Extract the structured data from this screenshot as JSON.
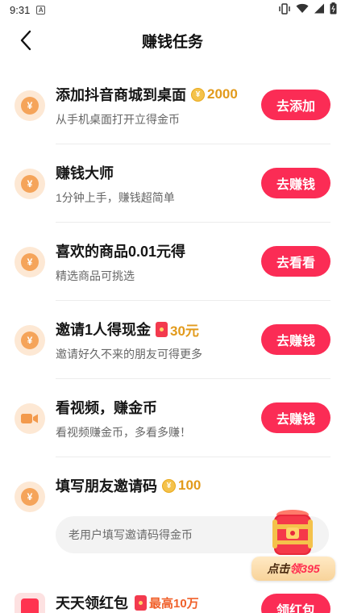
{
  "status_bar": {
    "time": "9:31"
  },
  "header": {
    "title": "赚钱任务"
  },
  "tasks": [
    {
      "title": "添加抖音商城到桌面",
      "reward": "2000",
      "subtitle": "从手机桌面打开立得金币",
      "button": "去添加",
      "icon": "coin-icon"
    },
    {
      "title": "赚钱大师",
      "reward": "",
      "subtitle": "1分钟上手，赚钱超简单",
      "button": "去赚钱",
      "icon": "coin-icon"
    },
    {
      "title": "喜欢的商品0.01元得",
      "reward": "",
      "subtitle": "精选商品可挑选",
      "button": "去看看",
      "icon": "coin-icon"
    },
    {
      "title": "邀请1人得现金",
      "reward": "30元",
      "subtitle": "邀请好久不来的朋友可得更多",
      "button": "去赚钱",
      "icon": "coin-icon"
    },
    {
      "title": "看视频，赚金币",
      "reward": "",
      "subtitle": "看视频赚金币，多看多赚！",
      "button": "去赚钱",
      "icon": "video-camera-icon"
    }
  ],
  "invite_code": {
    "title": "填写朋友邀请码",
    "reward": "100",
    "placeholder": "老用户填写邀请码得金币",
    "value": ""
  },
  "float_widget": {
    "label_a": "点击",
    "label_b": "领395"
  },
  "last_task": {
    "title": "天天领红包",
    "reward": "最高10万",
    "button": "领红包"
  },
  "colors": {
    "accent": "#fb2c55",
    "reward": "#e29a1b",
    "coin_bg": "#fde8d4"
  }
}
